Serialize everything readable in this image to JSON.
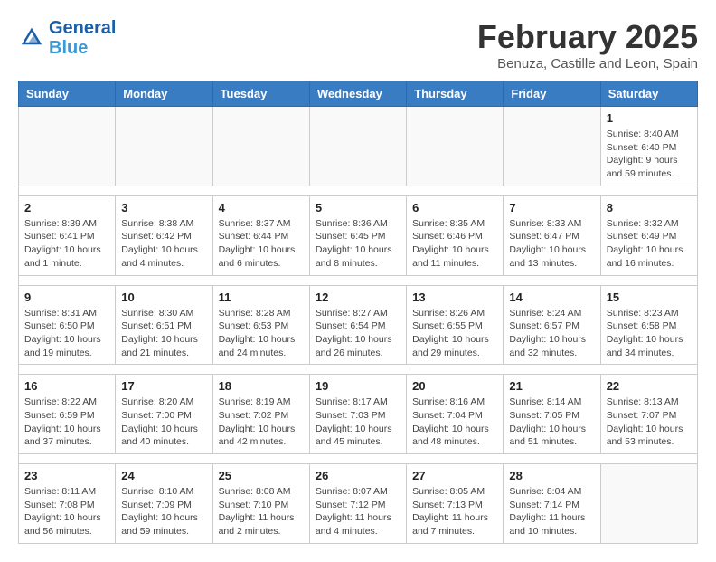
{
  "header": {
    "logo_line1": "General",
    "logo_line2": "Blue",
    "month": "February 2025",
    "location": "Benuza, Castille and Leon, Spain"
  },
  "days_of_week": [
    "Sunday",
    "Monday",
    "Tuesday",
    "Wednesday",
    "Thursday",
    "Friday",
    "Saturday"
  ],
  "weeks": [
    [
      {
        "day": "",
        "info": ""
      },
      {
        "day": "",
        "info": ""
      },
      {
        "day": "",
        "info": ""
      },
      {
        "day": "",
        "info": ""
      },
      {
        "day": "",
        "info": ""
      },
      {
        "day": "",
        "info": ""
      },
      {
        "day": "1",
        "info": "Sunrise: 8:40 AM\nSunset: 6:40 PM\nDaylight: 9 hours and 59 minutes."
      }
    ],
    [
      {
        "day": "2",
        "info": "Sunrise: 8:39 AM\nSunset: 6:41 PM\nDaylight: 10 hours and 1 minute."
      },
      {
        "day": "3",
        "info": "Sunrise: 8:38 AM\nSunset: 6:42 PM\nDaylight: 10 hours and 4 minutes."
      },
      {
        "day": "4",
        "info": "Sunrise: 8:37 AM\nSunset: 6:44 PM\nDaylight: 10 hours and 6 minutes."
      },
      {
        "day": "5",
        "info": "Sunrise: 8:36 AM\nSunset: 6:45 PM\nDaylight: 10 hours and 8 minutes."
      },
      {
        "day": "6",
        "info": "Sunrise: 8:35 AM\nSunset: 6:46 PM\nDaylight: 10 hours and 11 minutes."
      },
      {
        "day": "7",
        "info": "Sunrise: 8:33 AM\nSunset: 6:47 PM\nDaylight: 10 hours and 13 minutes."
      },
      {
        "day": "8",
        "info": "Sunrise: 8:32 AM\nSunset: 6:49 PM\nDaylight: 10 hours and 16 minutes."
      }
    ],
    [
      {
        "day": "9",
        "info": "Sunrise: 8:31 AM\nSunset: 6:50 PM\nDaylight: 10 hours and 19 minutes."
      },
      {
        "day": "10",
        "info": "Sunrise: 8:30 AM\nSunset: 6:51 PM\nDaylight: 10 hours and 21 minutes."
      },
      {
        "day": "11",
        "info": "Sunrise: 8:28 AM\nSunset: 6:53 PM\nDaylight: 10 hours and 24 minutes."
      },
      {
        "day": "12",
        "info": "Sunrise: 8:27 AM\nSunset: 6:54 PM\nDaylight: 10 hours and 26 minutes."
      },
      {
        "day": "13",
        "info": "Sunrise: 8:26 AM\nSunset: 6:55 PM\nDaylight: 10 hours and 29 minutes."
      },
      {
        "day": "14",
        "info": "Sunrise: 8:24 AM\nSunset: 6:57 PM\nDaylight: 10 hours and 32 minutes."
      },
      {
        "day": "15",
        "info": "Sunrise: 8:23 AM\nSunset: 6:58 PM\nDaylight: 10 hours and 34 minutes."
      }
    ],
    [
      {
        "day": "16",
        "info": "Sunrise: 8:22 AM\nSunset: 6:59 PM\nDaylight: 10 hours and 37 minutes."
      },
      {
        "day": "17",
        "info": "Sunrise: 8:20 AM\nSunset: 7:00 PM\nDaylight: 10 hours and 40 minutes."
      },
      {
        "day": "18",
        "info": "Sunrise: 8:19 AM\nSunset: 7:02 PM\nDaylight: 10 hours and 42 minutes."
      },
      {
        "day": "19",
        "info": "Sunrise: 8:17 AM\nSunset: 7:03 PM\nDaylight: 10 hours and 45 minutes."
      },
      {
        "day": "20",
        "info": "Sunrise: 8:16 AM\nSunset: 7:04 PM\nDaylight: 10 hours and 48 minutes."
      },
      {
        "day": "21",
        "info": "Sunrise: 8:14 AM\nSunset: 7:05 PM\nDaylight: 10 hours and 51 minutes."
      },
      {
        "day": "22",
        "info": "Sunrise: 8:13 AM\nSunset: 7:07 PM\nDaylight: 10 hours and 53 minutes."
      }
    ],
    [
      {
        "day": "23",
        "info": "Sunrise: 8:11 AM\nSunset: 7:08 PM\nDaylight: 10 hours and 56 minutes."
      },
      {
        "day": "24",
        "info": "Sunrise: 8:10 AM\nSunset: 7:09 PM\nDaylight: 10 hours and 59 minutes."
      },
      {
        "day": "25",
        "info": "Sunrise: 8:08 AM\nSunset: 7:10 PM\nDaylight: 11 hours and 2 minutes."
      },
      {
        "day": "26",
        "info": "Sunrise: 8:07 AM\nSunset: 7:12 PM\nDaylight: 11 hours and 4 minutes."
      },
      {
        "day": "27",
        "info": "Sunrise: 8:05 AM\nSunset: 7:13 PM\nDaylight: 11 hours and 7 minutes."
      },
      {
        "day": "28",
        "info": "Sunrise: 8:04 AM\nSunset: 7:14 PM\nDaylight: 11 hours and 10 minutes."
      },
      {
        "day": "",
        "info": ""
      }
    ]
  ]
}
